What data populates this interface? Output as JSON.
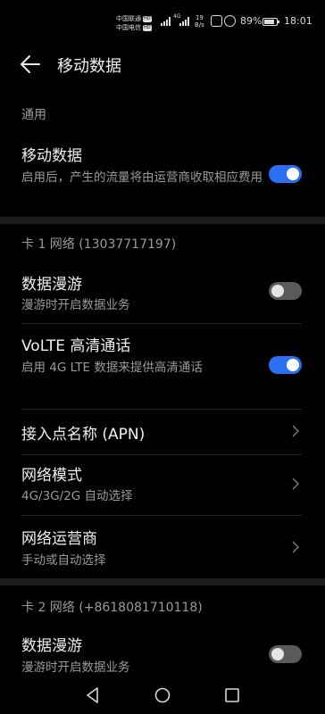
{
  "status_bar": {
    "carrier_1": "中国联通",
    "carrier_2": "中国电信",
    "hd_badge": "HD",
    "network_type": "4G",
    "speed_value": "19",
    "speed_unit": "B/s",
    "battery_percent": "89%",
    "time": "18:01"
  },
  "header": {
    "title": "移动数据"
  },
  "general": {
    "section_label": "通用",
    "mobile_data": {
      "title": "移动数据",
      "subtitle": "启用后，产生的流量将由运营商收取相应费用",
      "enabled": true
    }
  },
  "sim1": {
    "section_label": "卡 1 网络 (13037717197)",
    "data_roaming": {
      "title": "数据漫游",
      "subtitle": "漫游时开启数据业务",
      "enabled": false
    },
    "volte": {
      "title": "VoLTE 高清通话",
      "subtitle": "启用 4G LTE 数据来提供高清通话",
      "enabled": true
    },
    "apn": {
      "title": "接入点名称 (APN)"
    },
    "network_mode": {
      "title": "网络模式",
      "subtitle": "4G/3G/2G 自动选择"
    },
    "carrier": {
      "title": "网络运营商",
      "subtitle": "手动或自动选择"
    }
  },
  "sim2": {
    "section_label": "卡 2 网络 (+8618081710118)",
    "data_roaming": {
      "title": "数据漫游",
      "subtitle": "漫游时开启数据业务",
      "enabled": false
    }
  },
  "colors": {
    "accent": "#2a6ff2",
    "background": "#000000"
  },
  "icons": [
    "back-arrow-icon",
    "chevron-right-icon",
    "nav-back-icon",
    "nav-home-icon",
    "nav-recents-icon"
  ]
}
